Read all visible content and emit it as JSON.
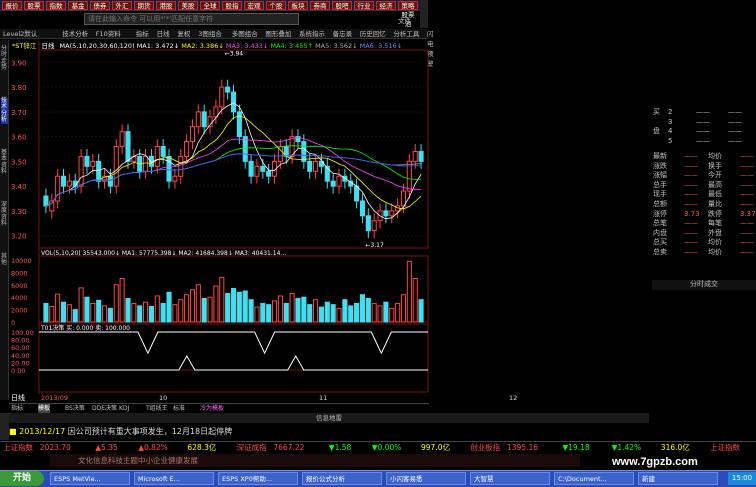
{
  "top_buttons": [
    "报价",
    "股票",
    "指数",
    "基金",
    "债券",
    "外汇",
    "期货",
    "港股",
    "美股",
    "全球",
    "股指",
    "宏观",
    "个股",
    "板块",
    "券商",
    "股吧",
    "行业",
    "经济",
    "策略股票池"
  ],
  "command_placeholder": "请在此输入命令     可以用*'*'匹配任意字符",
  "window_title": "文件",
  "tabs2": [
    "Level2默认",
    "技术分析",
    "F10资料",
    "指标",
    "日线",
    "复权",
    "3图组合",
    "多图组合",
    "图形叠加",
    "系统指示",
    "备忘录",
    "历史回忆",
    "分析工具",
    "闪电预警"
  ],
  "side_tabs": [
    "分时走势",
    "技术分析",
    "基本资料",
    "深度资料",
    "其他"
  ],
  "header": {
    "name": "*ST锌江",
    "period": "日线",
    "ma_label": "MA(5,10,20,30,60,120)",
    "ma1": "MA1: 3.472↓",
    "ma2": "MA2: 3.386↓",
    "ma3": "MA3: 3.433↓",
    "ma4": "MA4: 3.455↑",
    "ma5": "MA5: 3.562↓",
    "ma6": "MA6: 3.516↓"
  },
  "vol_legend": {
    "label": "VOL(5,10,20)",
    "v": "35543.000↓",
    "ma1": "MA1: 57775.398↓",
    "ma2": "MA2: 41684.398↓",
    "ma3": "MA3: 40431.14..."
  },
  "ind_legend": {
    "label": "T01决策",
    "v1": "买: 0.000",
    "v2": "卖: 100.000"
  },
  "price_axis": [
    "3.90",
    "3.80",
    "3.70",
    "3.60",
    "3.50",
    "3.40",
    "3.30",
    "3.20"
  ],
  "vol_axis": [
    "10000",
    "8000",
    "6000",
    "4000",
    "2000",
    "0"
  ],
  "ind_axis": [
    "100.00",
    "80.00",
    "60.00",
    "40.00",
    "20.00",
    "0.00"
  ],
  "ind2_axis": [
    "100.00",
    "80.00",
    "60.00",
    "40.00",
    "20.00",
    "0.00"
  ],
  "high_label": "3.94",
  "low_label": "3.17",
  "date_axis": [
    "2013/09",
    "10",
    "11",
    "12"
  ],
  "ann_date": "2013/12/17",
  "right_panel": {
    "book": [
      {
        "l": "买",
        "v": "2"
      },
      {
        "l": "",
        "v": "3"
      },
      {
        "l": "盘",
        "v": "4"
      },
      {
        "l": "",
        "v": "5"
      }
    ],
    "rows": [
      {
        "l": "最新",
        "v": "",
        "l2": "均价",
        "v2": ""
      },
      {
        "l": "涨跌",
        "v": "",
        "l2": "换手",
        "v2": ""
      },
      {
        "l": "涨幅",
        "v": "",
        "l2": "今开",
        "v2": ""
      },
      {
        "l": "总手",
        "v": "",
        "l2": "最高",
        "v2": ""
      },
      {
        "l": "现手",
        "v": "",
        "l2": "最低",
        "v2": ""
      },
      {
        "l": "总额",
        "v": "",
        "l2": "量比",
        "v2": ""
      },
      {
        "l": "涨停",
        "v": "3.73",
        "l2": "跌停",
        "v2": "3.37"
      },
      {
        "l": "总笔",
        "v": "",
        "l2": "每笔",
        "v2": ""
      },
      {
        "l": "内盘",
        "v": "",
        "l2": "外盘",
        "v2": ""
      },
      {
        "l": "总买",
        "v": "",
        "l2": "均价",
        "v2": ""
      },
      {
        "l": "总卖",
        "v": "",
        "l2": "均价",
        "v2": ""
      }
    ],
    "tab": "分时成交"
  },
  "bottom_tabs": [
    "指标",
    "模板",
    "BS决策",
    "DDE决策",
    "KDJ",
    "T组线王",
    "标准",
    "冷为模板"
  ],
  "news_header": "信息地雷",
  "news_text": "因公司预计有重大事项发生，12月18日起停牌",
  "ticker": [
    {
      "t": "上证指数",
      "c": "#ff4444"
    },
    {
      "t": "2023.70",
      "c": "#ff4444"
    },
    {
      "t": "▲5.35",
      "c": "#ff4444"
    },
    {
      "t": "▲0.82%",
      "c": "#ff4444"
    },
    {
      "t": "628.3亿",
      "c": "#ffff00"
    },
    {
      "t": "深证成指",
      "c": "#ff4444"
    },
    {
      "t": "7667.22",
      "c": "#ff4444"
    },
    {
      "t": "▼1.58",
      "c": "#00ff00"
    },
    {
      "t": "▼0.00%",
      "c": "#00ff00"
    },
    {
      "t": "997.0亿",
      "c": "#ffff00"
    },
    {
      "t": "创业板指",
      "c": "#ff4444"
    },
    {
      "t": "1395.16",
      "c": "#ff4444"
    },
    {
      "t": "▼19.18",
      "c": "#00ff00"
    },
    {
      "t": "▼1.42%",
      "c": "#00ff00"
    },
    {
      "t": "316.0亿",
      "c": "#ffff00"
    },
    {
      "t": "上证指数",
      "c": "#ff4444"
    }
  ],
  "ad": "文化信息科技主题中小企业健康发展",
  "taskbar": {
    "start": "开始",
    "items": [
      "ESPS MetVie...",
      "Microsoft E...",
      "ESPS XP0帮助...",
      "报价公式分析",
      "小闪客易悉",
      "大智慧",
      "C:\\Document...",
      "新建"
    ],
    "clock": "15:00"
  },
  "watermark": "www.7gpzb.com",
  "chart_data": {
    "type": "candlestick",
    "price_range": [
      3.15,
      3.95
    ],
    "candles": [
      {
        "o": 3.36,
        "c": 3.32
      },
      {
        "o": 3.3,
        "c": 3.34
      },
      {
        "o": 3.34,
        "c": 3.44
      },
      {
        "o": 3.44,
        "c": 3.4
      },
      {
        "o": 3.4,
        "c": 3.42
      },
      {
        "o": 3.42,
        "c": 3.4
      },
      {
        "o": 3.4,
        "c": 3.52
      },
      {
        "o": 3.52,
        "c": 3.48
      },
      {
        "o": 3.48,
        "c": 3.5
      },
      {
        "o": 3.5,
        "c": 3.42
      },
      {
        "o": 3.42,
        "c": 3.44
      },
      {
        "o": 3.44,
        "c": 3.4
      },
      {
        "o": 3.4,
        "c": 3.56
      },
      {
        "o": 3.56,
        "c": 3.62
      },
      {
        "o": 3.62,
        "c": 3.5
      },
      {
        "o": 3.5,
        "c": 3.52
      },
      {
        "o": 3.52,
        "c": 3.46
      },
      {
        "o": 3.46,
        "c": 3.52
      },
      {
        "o": 3.52,
        "c": 3.48
      },
      {
        "o": 3.48,
        "c": 3.56
      },
      {
        "o": 3.56,
        "c": 3.52
      },
      {
        "o": 3.52,
        "c": 3.42
      },
      {
        "o": 3.42,
        "c": 3.44
      },
      {
        "o": 3.44,
        "c": 3.52
      },
      {
        "o": 3.52,
        "c": 3.58
      },
      {
        "o": 3.58,
        "c": 3.64
      },
      {
        "o": 3.64,
        "c": 3.7
      },
      {
        "o": 3.7,
        "c": 3.64
      },
      {
        "o": 3.64,
        "c": 3.68
      },
      {
        "o": 3.68,
        "c": 3.72
      },
      {
        "o": 3.72,
        "c": 3.8
      },
      {
        "o": 3.8,
        "c": 3.78
      },
      {
        "o": 3.78,
        "c": 3.7
      },
      {
        "o": 3.7,
        "c": 3.6
      },
      {
        "o": 3.6,
        "c": 3.5
      },
      {
        "o": 3.5,
        "c": 3.44
      },
      {
        "o": 3.44,
        "c": 3.48
      },
      {
        "o": 3.48,
        "c": 3.46
      },
      {
        "o": 3.46,
        "c": 3.44
      },
      {
        "o": 3.44,
        "c": 3.5
      },
      {
        "o": 3.5,
        "c": 3.56
      },
      {
        "o": 3.56,
        "c": 3.52
      },
      {
        "o": 3.52,
        "c": 3.6
      },
      {
        "o": 3.6,
        "c": 3.58
      },
      {
        "o": 3.58,
        "c": 3.5
      },
      {
        "o": 3.5,
        "c": 3.46
      },
      {
        "o": 3.46,
        "c": 3.5
      },
      {
        "o": 3.5,
        "c": 3.48
      },
      {
        "o": 3.48,
        "c": 3.42
      },
      {
        "o": 3.42,
        "c": 3.4
      },
      {
        "o": 3.4,
        "c": 3.44
      },
      {
        "o": 3.44,
        "c": 3.42
      },
      {
        "o": 3.42,
        "c": 3.4
      },
      {
        "o": 3.4,
        "c": 3.34
      },
      {
        "o": 3.34,
        "c": 3.28
      },
      {
        "o": 3.28,
        "c": 3.22
      },
      {
        "o": 3.22,
        "c": 3.26
      },
      {
        "o": 3.26,
        "c": 3.3
      },
      {
        "o": 3.3,
        "c": 3.28
      },
      {
        "o": 3.28,
        "c": 3.3
      },
      {
        "o": 3.3,
        "c": 3.32
      },
      {
        "o": 3.32,
        "c": 3.38
      },
      {
        "o": 3.38,
        "c": 3.5
      },
      {
        "o": 3.5,
        "c": 3.54
      },
      {
        "o": 3.54,
        "c": 3.5
      }
    ],
    "volumes": [
      3000,
      2500,
      4500,
      3200,
      2800,
      2000,
      5500,
      4000,
      3000,
      3500,
      2600,
      2200,
      6000,
      7000,
      3800,
      3000,
      2600,
      3200,
      2500,
      4200,
      3000,
      4800,
      2800,
      3600,
      4400,
      5200,
      6000,
      3800,
      4000,
      5800,
      7200,
      4600,
      5400,
      4800,
      5000,
      3600,
      2400,
      3000,
      2800,
      3400,
      4200,
      3000,
      4600,
      3800,
      4000,
      2800,
      3600,
      2400,
      3200,
      2800,
      2200,
      3600,
      2600,
      3000,
      4400,
      3800,
      3000,
      2600,
      3200,
      2200,
      3000,
      4400,
      9800,
      7000,
      3600
    ],
    "indicator_top_dips": [
      0.28,
      0.58,
      0.88
    ],
    "indicator_bottom_peaks": [
      0.38,
      0.66
    ]
  }
}
